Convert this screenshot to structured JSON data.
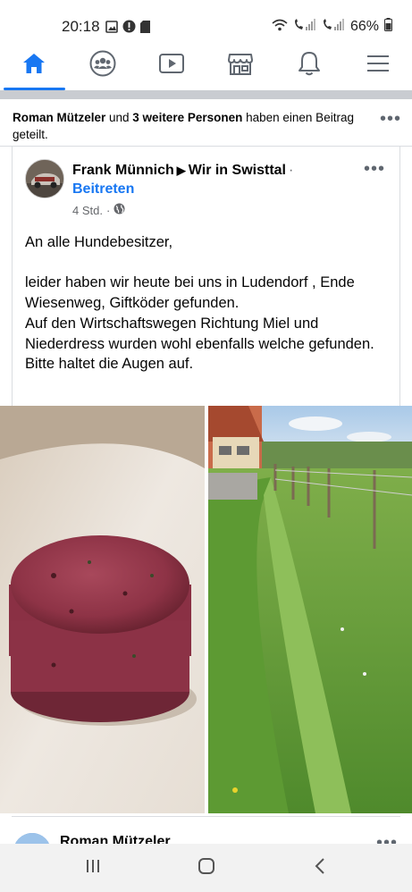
{
  "status_bar": {
    "time": "20:18",
    "battery": "66%",
    "icons": [
      "gallery-icon",
      "alert-icon",
      "sd-card-icon",
      "wifi-icon",
      "call-signal-1-icon",
      "call-signal-2-icon",
      "battery-icon"
    ]
  },
  "nav": {
    "items": [
      {
        "name": "home",
        "icon": "home-icon",
        "active": true
      },
      {
        "name": "groups",
        "icon": "groups-icon"
      },
      {
        "name": "watch",
        "icon": "video-icon"
      },
      {
        "name": "marketplace",
        "icon": "store-icon"
      },
      {
        "name": "notifications",
        "icon": "bell-icon"
      },
      {
        "name": "menu",
        "icon": "hamburger-icon"
      }
    ],
    "accent": "#1877f2"
  },
  "shared": {
    "actor": "Roman Mützeler",
    "connector": " und ",
    "others": "3 weitere Personen",
    "suffix": " haben einen Beitrag geteilt."
  },
  "post": {
    "author": "Frank Münnich",
    "group": "Wir in Swisttal",
    "join": "Beitreten",
    "time": "4 Std.",
    "audience_icon": "globe-icon",
    "greeting": "An alle Hundebesitzer,",
    "paragraph": "leider haben wir heute bei uns in Ludendorf , Ende Wiesenweg, Giftköder gefunden.",
    "line2": "Auf den Wirtschaftswegen Richtung Miel und Niederdress wurden wohl ebenfalls welche gefunden.",
    "line3": "Bitte haltet die Augen auf."
  },
  "next_post": {
    "author": "Roman Mützeler"
  },
  "system_nav": [
    "recent-apps-icon",
    "home-button-icon",
    "back-icon"
  ]
}
